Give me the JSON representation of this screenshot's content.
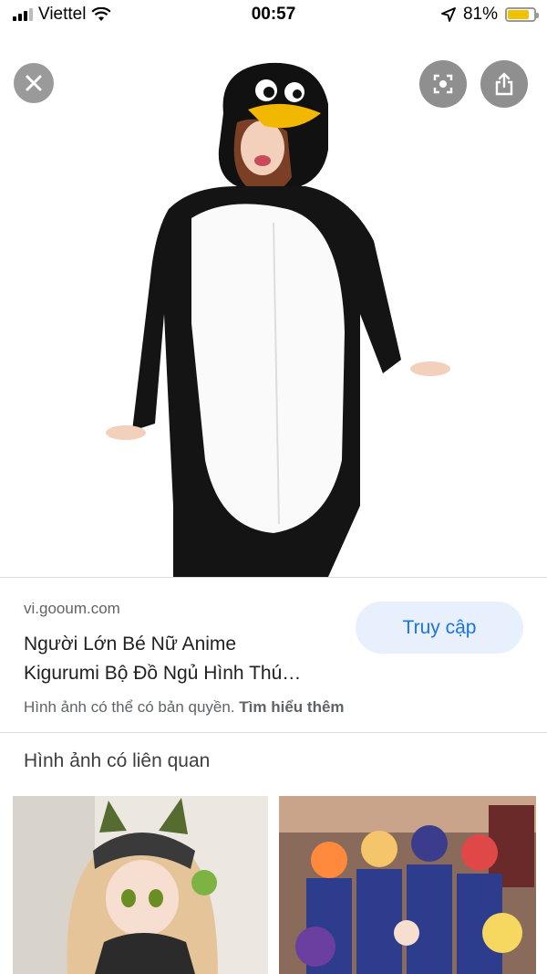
{
  "status_bar": {
    "carrier": "Viettel",
    "time": "00:57",
    "battery_percent": "81%",
    "battery_level": 0.81
  },
  "viewer": {
    "close_icon": "close-icon",
    "lens_icon": "lens-icon",
    "share_icon": "share-icon"
  },
  "result": {
    "domain": "vi.gooum.com",
    "title_line1": "Người Lớn Bé Nữ Anime",
    "title_line2": "Kigurumi Bộ Đồ Ngủ Hình Thú…",
    "visit_label": "Truy cập",
    "copyright_text": "Hình ảnh có thể có bản quyền.",
    "learn_more": "Tìm hiểu thêm"
  },
  "related": {
    "heading": "Hình ảnh có liên quan"
  },
  "colors": {
    "accent": "#1a73e8",
    "visit_bg": "#e8f0fe",
    "battery": "#f2c200"
  }
}
